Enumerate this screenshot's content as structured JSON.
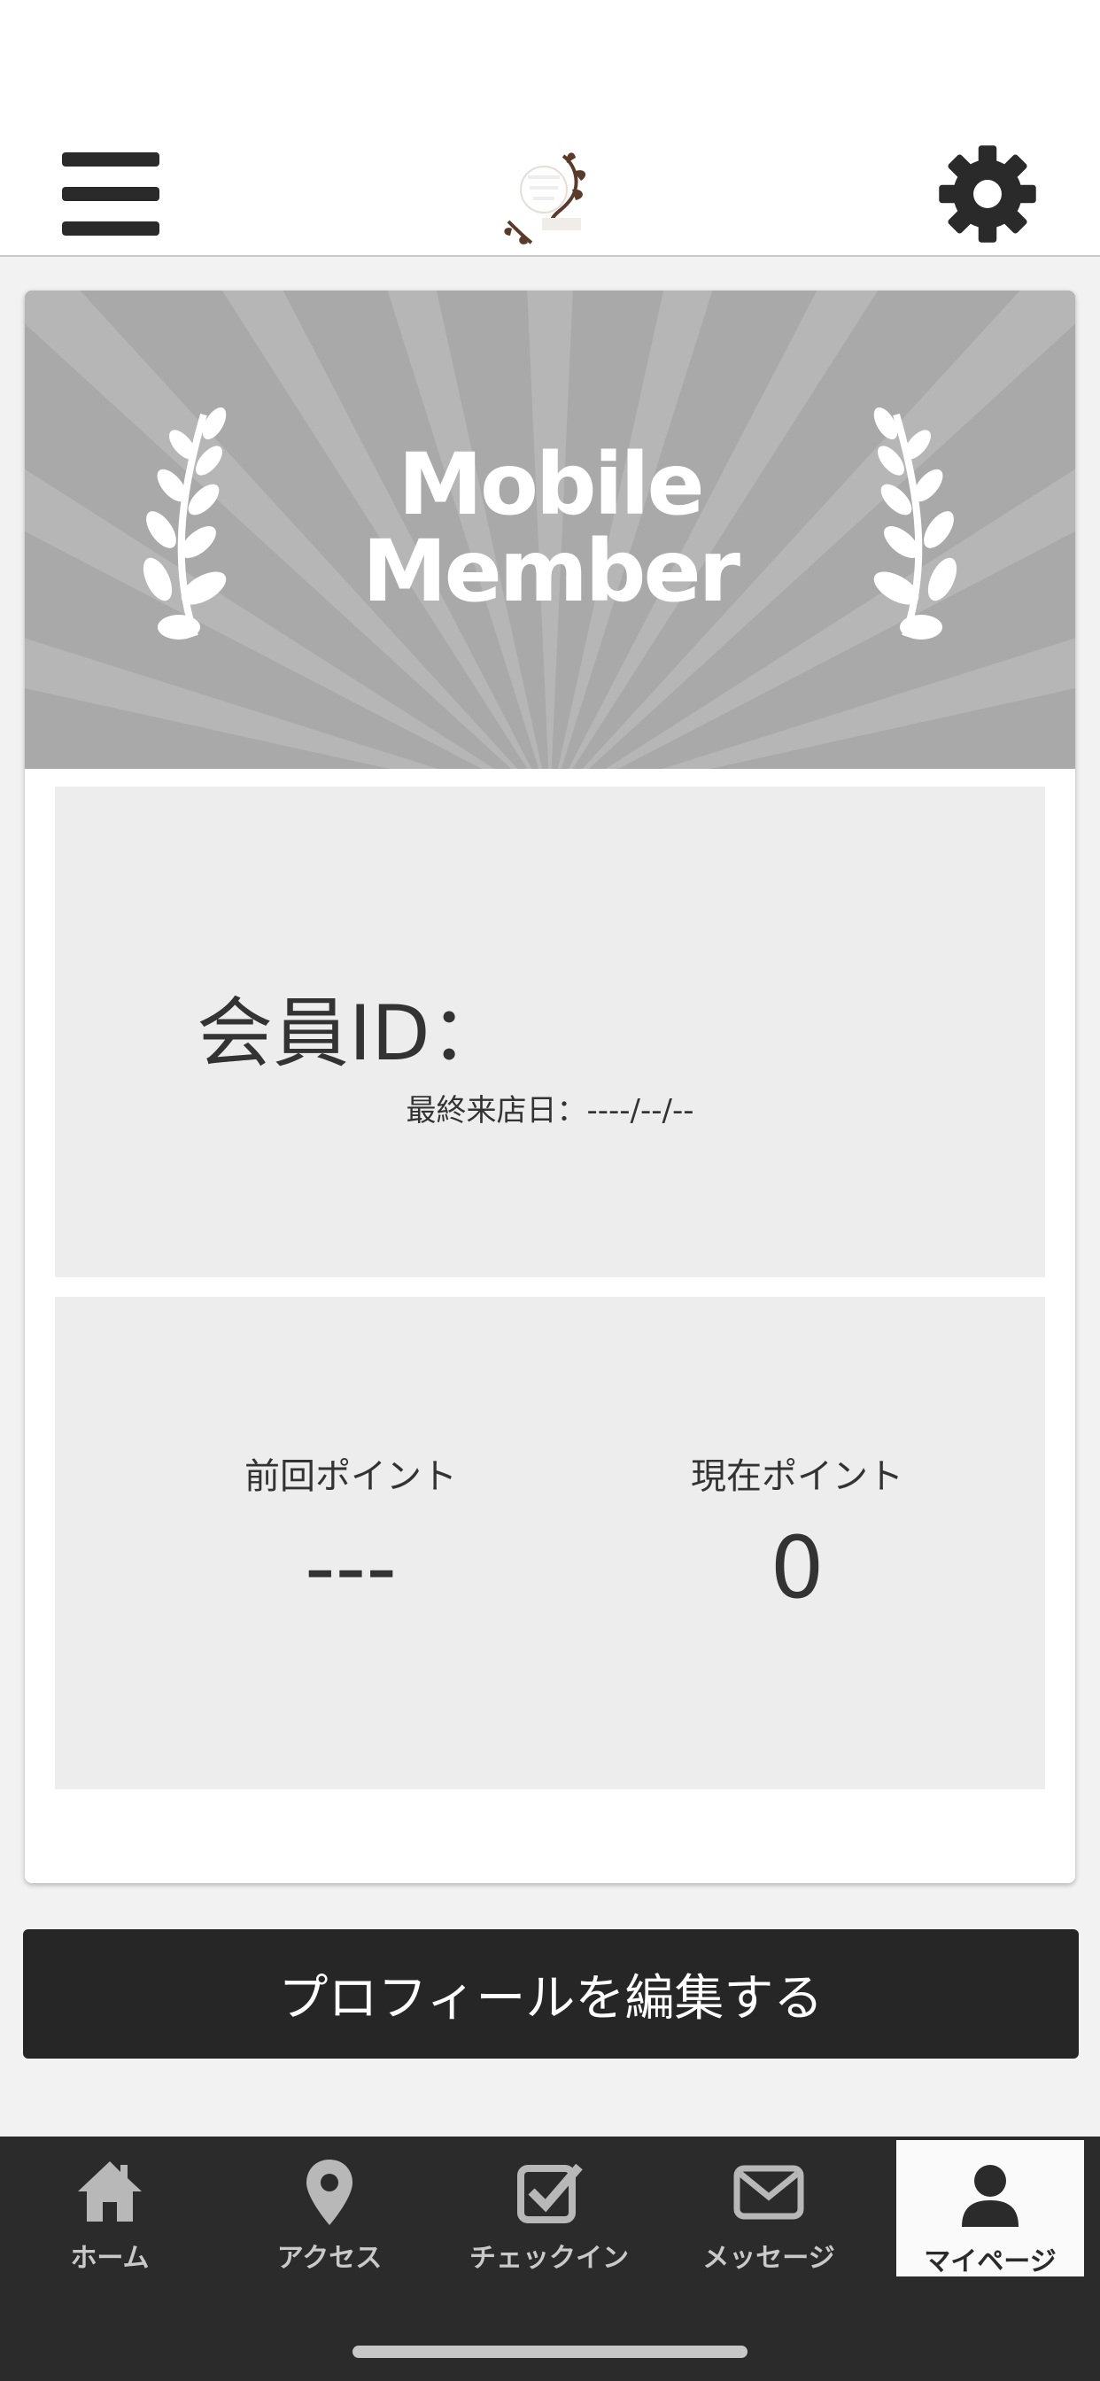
{
  "header": {
    "menu_icon": "hamburger-menu-icon",
    "logo_icon": "shop-logo",
    "settings_icon": "gear-icon"
  },
  "banner": {
    "title_line1": "Mobile",
    "title_line2": "Member",
    "icon": "laurel-icon"
  },
  "member": {
    "id_label": "会員ID：",
    "last_visit": "最終来店日：----/--/--"
  },
  "points": {
    "previous_label": "前回ポイント",
    "previous_value": "---",
    "current_label": "現在ポイント",
    "current_value": "0"
  },
  "edit_button_label": "プロフィールを編集する",
  "tabs": [
    {
      "label": "ホーム",
      "icon": "home-icon"
    },
    {
      "label": "アクセス",
      "icon": "map-pin-icon"
    },
    {
      "label": "チェックイン",
      "icon": "checkbox-icon"
    },
    {
      "label": "メッセージ",
      "icon": "envelope-icon"
    },
    {
      "label": "マイページ",
      "icon": "user-icon",
      "active": true
    }
  ],
  "colors": {
    "banner": "#a9a9a9",
    "panel": "#ededed",
    "button": "#262626",
    "tabbar": "#2b2b2b",
    "tab_active": "#fafafa"
  }
}
